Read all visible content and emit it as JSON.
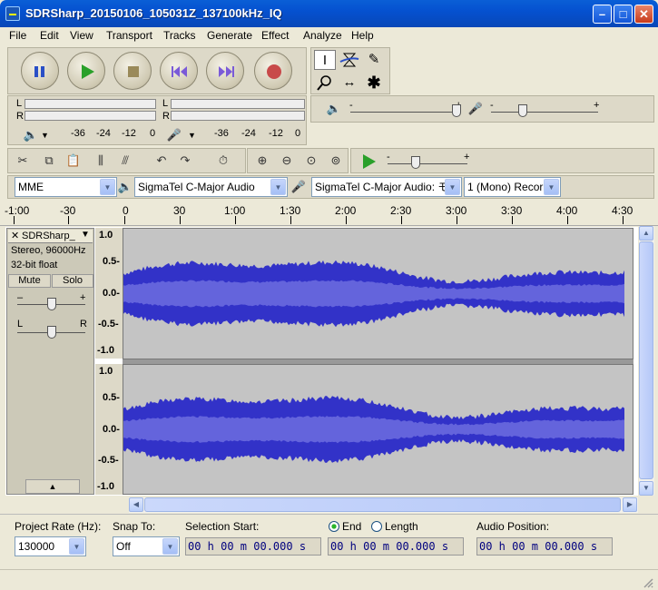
{
  "window": {
    "title": "SDRSharp_20150106_105031Z_137100kHz_IQ",
    "minimize": "–",
    "maximize": "□",
    "close": "✕"
  },
  "menu": [
    "File",
    "Edit",
    "View",
    "Transport",
    "Tracks",
    "Generate",
    "Effect",
    "Analyze",
    "Help"
  ],
  "meters": {
    "left_channel": "L",
    "right_channel": "R",
    "playback_scale": [
      "-36",
      "-24",
      "-12",
      "0"
    ],
    "record_scale": [
      "-36",
      "-24",
      "-12",
      "0"
    ]
  },
  "mixer": {
    "slider_min": "-",
    "slider_max": "+"
  },
  "devices": {
    "host": "MME",
    "output": "SigmaTel C-Major Audio",
    "input": "SigmaTel C-Major Audio: モ",
    "channels": "1 (Mono) Recor"
  },
  "ruler": [
    "-1:00",
    "-30",
    "0",
    "30",
    "1:00",
    "1:30",
    "2:00",
    "2:30",
    "3:00",
    "3:30",
    "4:00",
    "4:30"
  ],
  "track": {
    "name": "SDRSharp_",
    "close": "✕",
    "menu_arrow": "▼",
    "info_line1": "Stereo, 96000Hz",
    "info_line2": "32-bit float",
    "mute": "Mute",
    "solo": "Solo",
    "gain_min": "–",
    "gain_max": "+",
    "pan_left": "L",
    "pan_right": "R",
    "collapse": "▲",
    "vscale": [
      "1.0",
      "0.5-",
      "0.0-",
      "-0.5-",
      "-1.0"
    ]
  },
  "bottom": {
    "project_rate_label": "Project Rate (Hz):",
    "project_rate_value": "130000",
    "snap_to_label": "Snap To:",
    "snap_to_value": "Off",
    "selection_start_label": "Selection Start:",
    "end_label": "End",
    "length_label": "Length",
    "audio_position_label": "Audio Position:",
    "selection_start_value": "00 h 00 m 00.000 s",
    "selection_end_value": "00 h 00 m 00.000 s",
    "audio_position_value": "00 h 00 m 00.000 s"
  },
  "colors": {
    "waveform_outer": "#3232c8",
    "waveform_inner": "#6464dc",
    "waveform_bg": "#c4c4c4",
    "titlebar": "#0a5fd6"
  }
}
